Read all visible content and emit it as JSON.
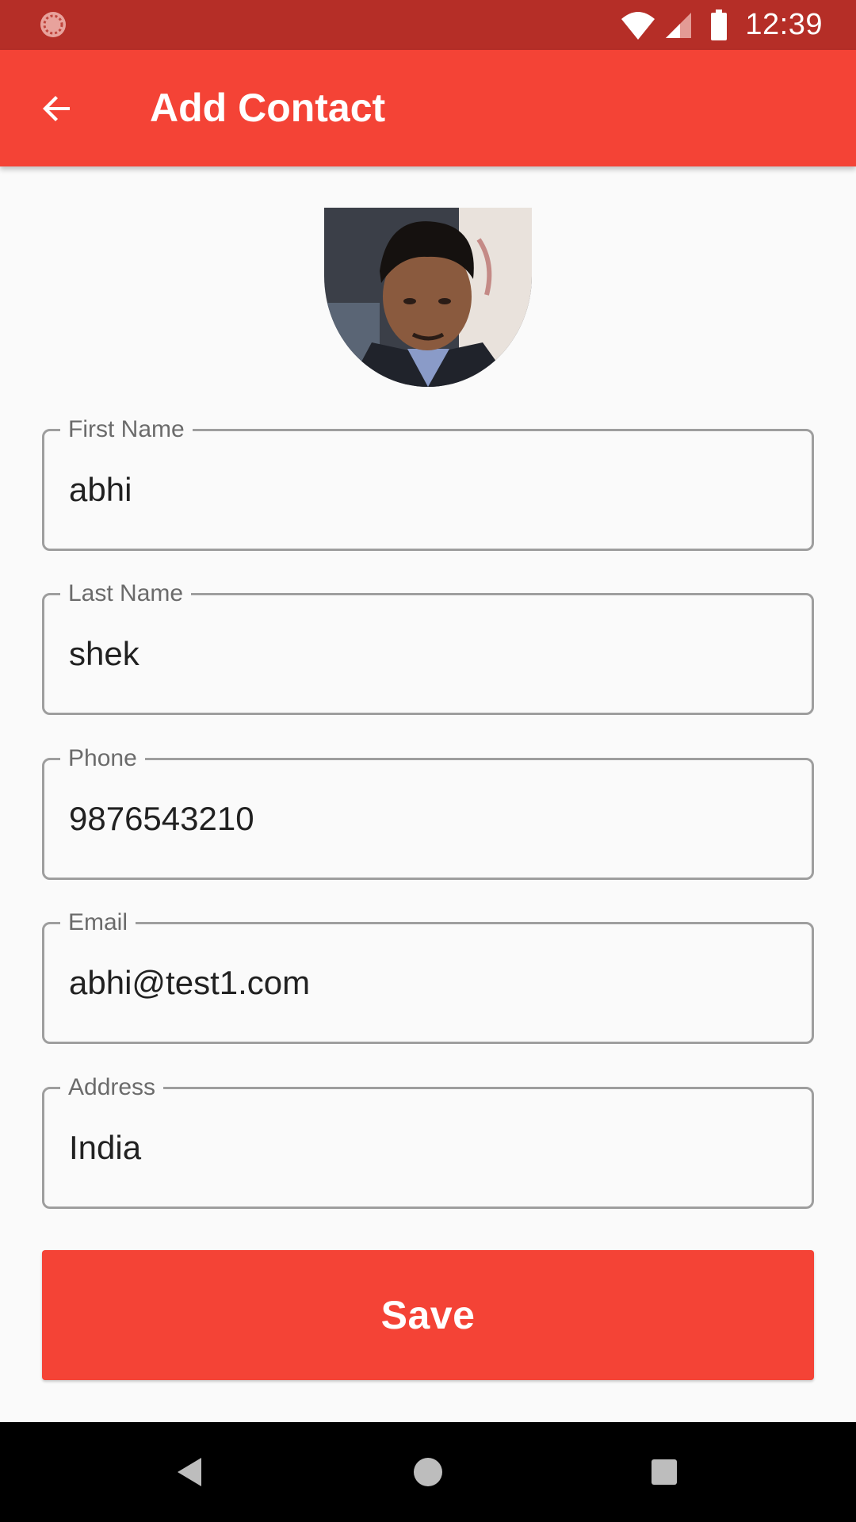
{
  "status_bar": {
    "time": "12:39",
    "icons": [
      "notification-icon",
      "wifi-icon",
      "signal-icon",
      "battery-icon"
    ]
  },
  "app_bar": {
    "title": "Add Contact",
    "back_icon": "arrow-back-icon",
    "color": "#f44336"
  },
  "avatar": {
    "icon": "profile-photo"
  },
  "form": {
    "first_name": {
      "label": "First Name",
      "value": "abhi"
    },
    "last_name": {
      "label": "Last Name",
      "value": "shek"
    },
    "phone": {
      "label": "Phone",
      "value": "9876543210"
    },
    "email": {
      "label": "Email",
      "value": "abhi@test1.com"
    },
    "address": {
      "label": "Address",
      "value": "India"
    }
  },
  "save_button": {
    "label": "Save",
    "color": "#f44336"
  },
  "nav_bar": {
    "icons": [
      "back-triangle-icon",
      "home-circle-icon",
      "recents-square-icon"
    ]
  }
}
